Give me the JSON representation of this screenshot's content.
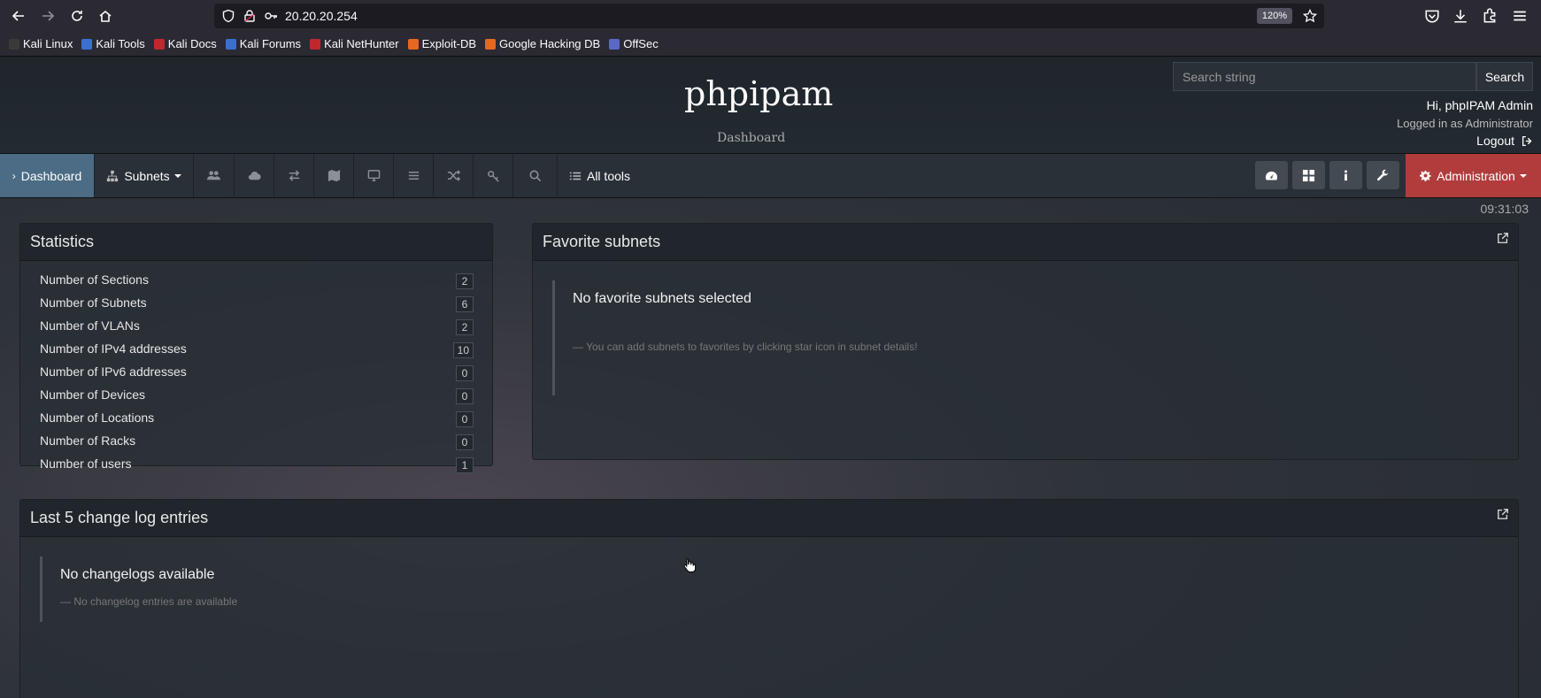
{
  "browser": {
    "url": "20.20.20.254",
    "zoom": "120%",
    "bookmarks": [
      {
        "label": "Kali Linux",
        "color": "#3a3a3a"
      },
      {
        "label": "Kali Tools",
        "color": "#3b6fd0"
      },
      {
        "label": "Kali Docs",
        "color": "#c0282d"
      },
      {
        "label": "Kali Forums",
        "color": "#3b6fd0"
      },
      {
        "label": "Kali NetHunter",
        "color": "#c0282d"
      },
      {
        "label": "Exploit-DB",
        "color": "#e8671e"
      },
      {
        "label": "Google Hacking DB",
        "color": "#e8671e"
      },
      {
        "label": "OffSec",
        "color": "#5a68c8"
      }
    ]
  },
  "header": {
    "brand": "phpipam",
    "subtitle": "Dashboard",
    "search_placeholder": "Search string",
    "search_button": "Search",
    "user_greeting": "Hi, phpIPAM Admin",
    "role_text": "Logged in as  Administrator",
    "logout": "Logout"
  },
  "menu": {
    "dashboard": "Dashboard",
    "subnets": "Subnets",
    "all_tools": "All tools",
    "administration": "Administration",
    "icons": [
      "users-icon",
      "cloud-icon",
      "exchange-icon",
      "map-icon",
      "desktop-icon",
      "list-icon",
      "random-icon",
      "key-icon",
      "search-icon"
    ],
    "tool_buttons": [
      "dashboard-icon",
      "th-large-icon",
      "info-icon",
      "wrench-icon"
    ]
  },
  "clock": "09:31:03",
  "statistics": {
    "title": "Statistics",
    "rows": [
      {
        "label": "Number of Sections",
        "value": "2"
      },
      {
        "label": "Number of Subnets",
        "value": "6"
      },
      {
        "label": "Number of VLANs",
        "value": "2"
      },
      {
        "label": "Number of IPv4 addresses",
        "value": "10"
      },
      {
        "label": "Number of IPv6 addresses",
        "value": "0"
      },
      {
        "label": "Number of Devices",
        "value": "0"
      },
      {
        "label": "Number of Locations",
        "value": "0"
      },
      {
        "label": "Number of Racks",
        "value": "0"
      },
      {
        "label": "Number of users",
        "value": "1"
      }
    ]
  },
  "favorites": {
    "title": "Favorite subnets",
    "empty_title": "No favorite subnets selected",
    "empty_hint": "— You can add subnets to favorites by clicking star icon in subnet details!"
  },
  "changelog": {
    "title": "Last 5 change log entries",
    "empty_title": "No changelogs available",
    "empty_hint": "— No changelog entries are available"
  }
}
